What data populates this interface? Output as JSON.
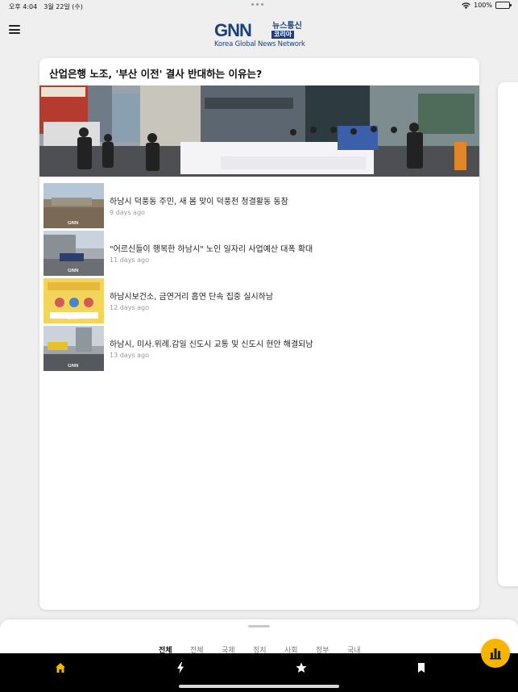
{
  "status": {
    "time": "오후 4:04",
    "date": "3월 22일 (수)",
    "battery": "100%",
    "battery_level": 1.0
  },
  "header": {
    "logo_main": "GNN",
    "logo_news": "뉴스통신",
    "logo_korea": "코리아",
    "logo_tagline": "Korea Global News Network",
    "menu_icon": "hamburger-icon"
  },
  "featured": {
    "title": "산업은행 노조, '부산 이전' 결사 반대하는 이유는?",
    "image_icon": "protest-photo"
  },
  "articles": [
    {
      "title": "하남시 덕풍동 주민, 새 봄 맞이 덕풍천 청결활동 동참",
      "time": "9 days ago"
    },
    {
      "title": "\"어르신들이 행복한 하남시\" 노인 일자리 사업예산 대폭 확대",
      "time": "11 days ago"
    },
    {
      "title": "하남시보건소, 금연거리 흡연 단속 집중 실시하남",
      "time": "12 days ago"
    },
    {
      "title": "하남시, 미사.위례.감일 신도시 교통 및 신도시 현안 해결되남",
      "time": "13 days ago"
    }
  ],
  "thumb_watermark": "GNN",
  "categories": [
    "전체",
    "전체",
    "국제",
    "정치",
    "사회",
    "정부",
    "국내"
  ],
  "active_category": 0,
  "tabs": [
    {
      "name": "home",
      "icon": "home-icon",
      "active": true
    },
    {
      "name": "flash",
      "icon": "lightning-icon",
      "active": false
    },
    {
      "name": "favorites",
      "icon": "star-icon",
      "active": false
    },
    {
      "name": "bookmarks",
      "icon": "bookmark-icon",
      "active": false
    }
  ],
  "colors": {
    "accent": "#f7b500",
    "brand": "#1d3f7a",
    "tab_active": "#f7b500",
    "tab_inactive": "#ffffff"
  }
}
